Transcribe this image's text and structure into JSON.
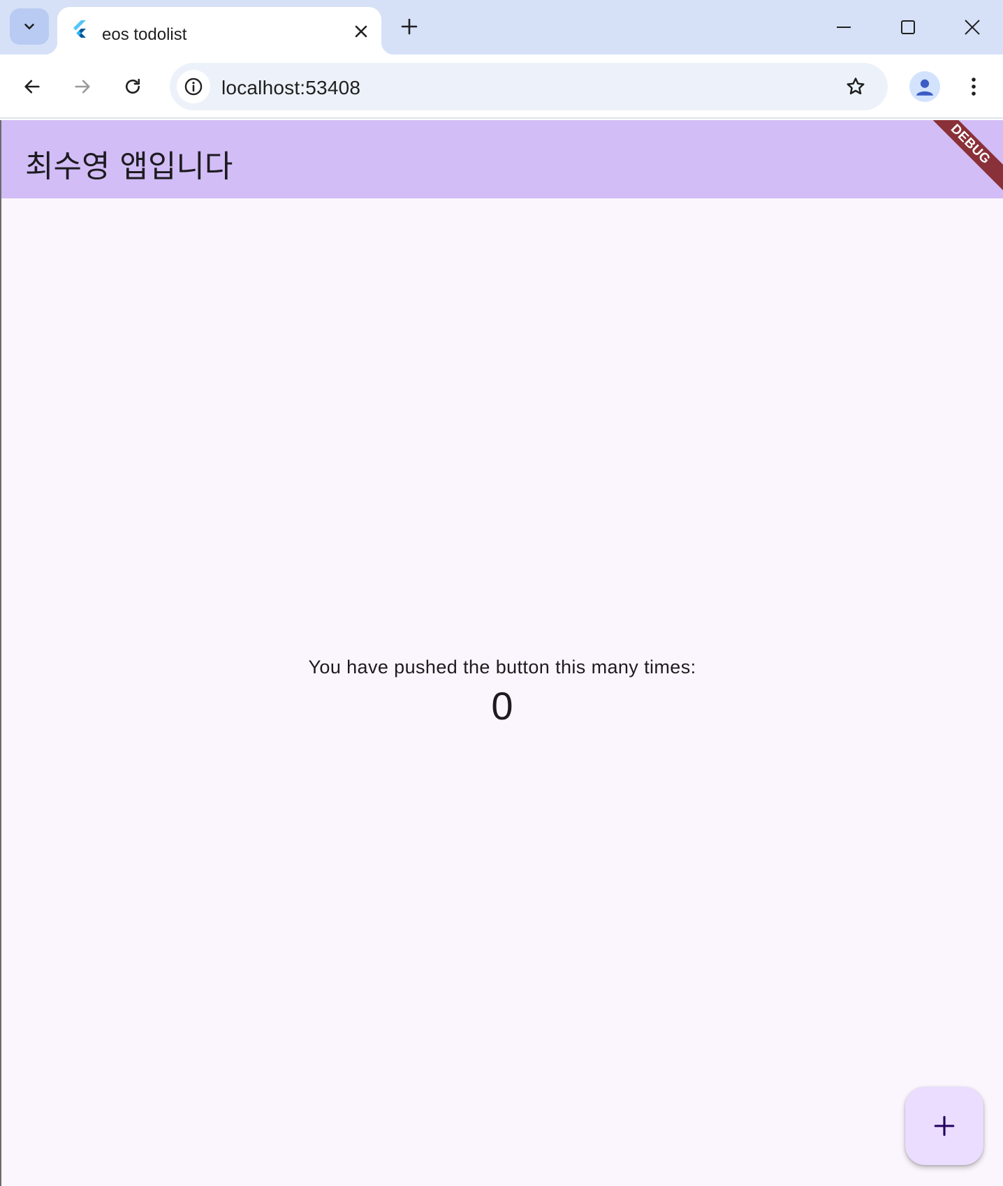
{
  "browser": {
    "tab": {
      "title": "eos todolist"
    },
    "address": {
      "url": "localhost:53408"
    }
  },
  "app": {
    "appbar": {
      "title": "최수영 앱입니다"
    },
    "debug_banner": "DEBUG",
    "counter": {
      "label": "You have pushed the button this many times:",
      "value": "0"
    }
  },
  "colors": {
    "tabstrip": "#d6e1f8",
    "appbar": "#d2bdf6",
    "app_background": "#fbf6fd",
    "fab": "#eaddff",
    "debug_ribbon": "#8a3038"
  },
  "icons": [
    "chevron-down-icon",
    "flutter-logo-icon",
    "close-icon",
    "plus-icon",
    "minimize-icon",
    "maximize-icon",
    "window-close-icon",
    "back-arrow-icon",
    "forward-arrow-icon",
    "reload-icon",
    "info-icon",
    "star-icon",
    "profile-icon",
    "kebab-menu-icon",
    "add-icon"
  ]
}
